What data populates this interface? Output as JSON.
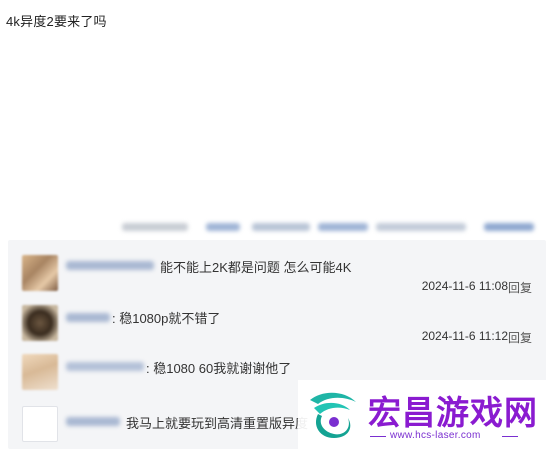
{
  "post": {
    "title": "4k异度2要来了吗"
  },
  "comments": [
    {
      "text": "能不能上2K都是问题 怎么可能4K",
      "time": "2024-11-6 11:08",
      "reply": "回复"
    },
    {
      "text": ": 稳1080p就不错了",
      "time": "2024-11-6 11:12",
      "reply": "回复"
    },
    {
      "text": ": 稳1080 60我就谢谢他了",
      "time": "",
      "reply": ""
    },
    {
      "text": "我马上就要玩到高清重置版异度",
      "time": "",
      "reply": ""
    }
  ],
  "watermark": {
    "title": "宏昌游戏网",
    "url": "www.hcs-laser.com"
  },
  "colors": {
    "panel_bg": "#f4f5f7",
    "watermark_purple": "#8a1bd0"
  }
}
